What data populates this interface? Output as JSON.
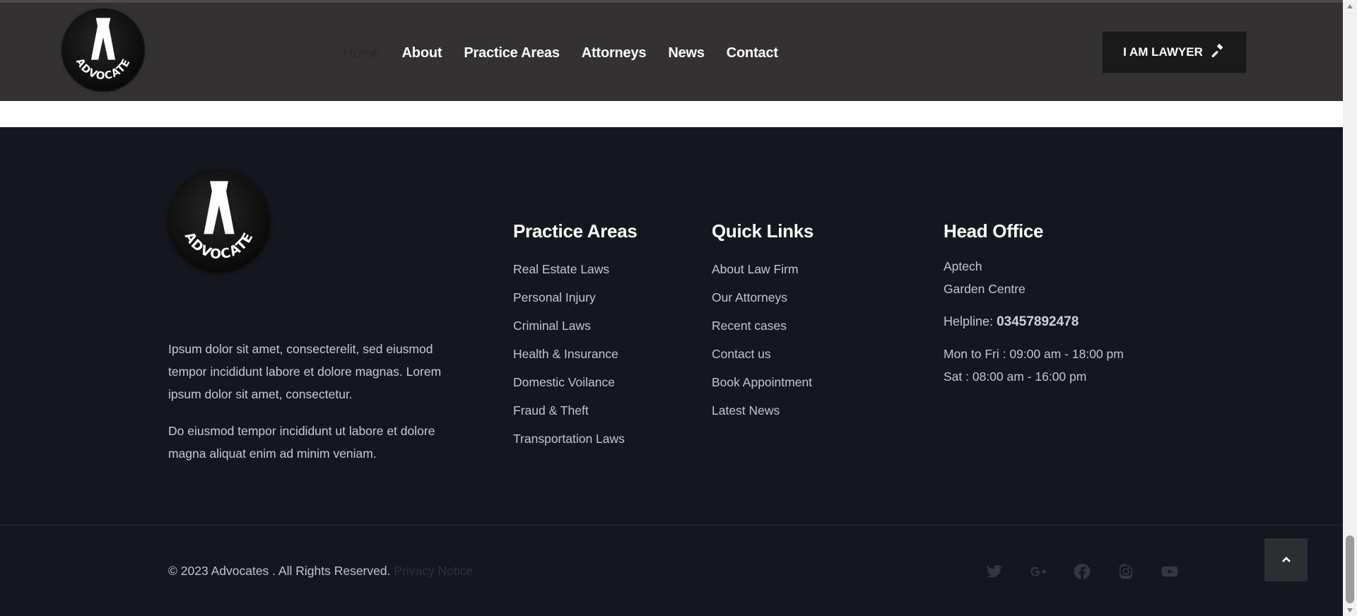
{
  "header": {
    "logo_text": "ADVOCATE",
    "nav": [
      {
        "label": "Home",
        "active": true
      },
      {
        "label": "About"
      },
      {
        "label": "Practice Areas"
      },
      {
        "label": "Attorneys"
      },
      {
        "label": "News"
      },
      {
        "label": "Contact"
      }
    ],
    "cta_label": "I AM LAWYER",
    "cta_icon": "gavel-icon"
  },
  "footer": {
    "logo_text": "ADVOCATE",
    "about_paragraphs": [
      "Ipsum dolor sit amet, consecterelit, sed eiusmod tempor incididunt labore et dolore magnas. Lorem ipsum dolor sit amet, consectetur.",
      "Do eiusmod tempor incididunt ut labore et dolore magna aliquat enim ad minim veniam."
    ],
    "practice_areas": {
      "title": "Practice Areas",
      "items": [
        "Real Estate Laws",
        "Personal Injury",
        "Criminal Laws",
        "Health & Insurance",
        "Domestic Voilance",
        "Fraud & Theft",
        "Transportation Laws"
      ]
    },
    "quick_links": {
      "title": "Quick Links",
      "items": [
        "About Law Firm",
        "Our Attorneys",
        "Recent cases",
        "Contact us",
        "Book Appointment",
        "Latest News"
      ]
    },
    "head_office": {
      "title": "Head Office",
      "address_lines": [
        "Aptech",
        "Garden Centre"
      ],
      "helpline_label": "Helpline:",
      "helpline_number": "03457892478",
      "hours": [
        "Mon to Fri : 09:00 am - 18:00 pm",
        "Sat : 08:00 am - 16:00 pm"
      ]
    },
    "copyright": "© 2023 Advocates . All Rights Reserved.",
    "privacy_label": "Privacy Notice",
    "social_icons": [
      "twitter-icon",
      "google-plus-icon",
      "facebook-icon",
      "instagram-icon",
      "youtube-icon"
    ],
    "back_to_top_icon": "chevron-up-icon"
  },
  "colors": {
    "header_bg": "#333132",
    "footer_bg": "#15171e",
    "heading": "#ffffff",
    "text": "#c4c5c9"
  }
}
